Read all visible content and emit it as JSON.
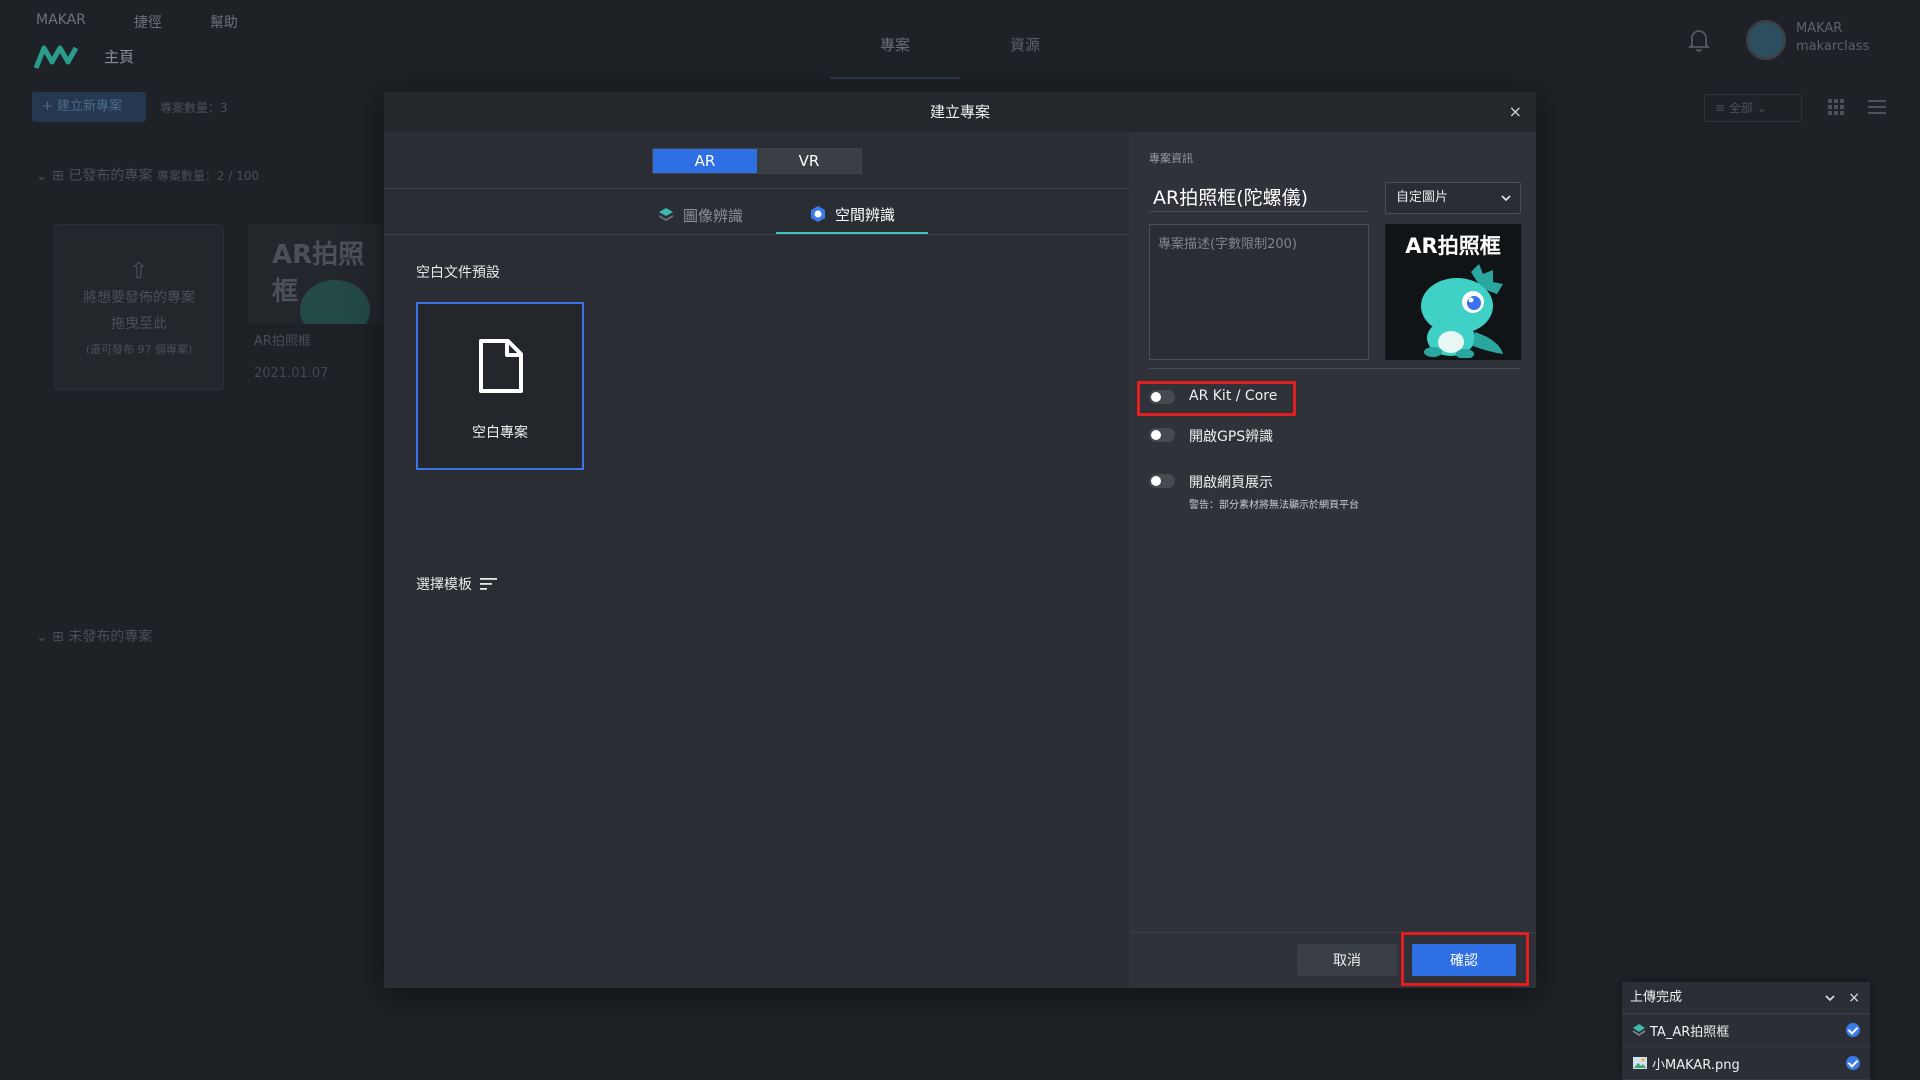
{
  "app": {
    "menu": [
      "MAKAR",
      "捷徑",
      "幫助"
    ],
    "home_label": "主頁",
    "top_tabs": [
      "專案",
      "資源"
    ],
    "user": {
      "name": "MAKAR",
      "handle": "makarclass"
    },
    "new_project_label": "+ 建立新專案",
    "project_count_label": "專案數量：3",
    "view_filter_label": "全部",
    "published_section": "已發布的專案",
    "published_count": "專案數量：2 / 100",
    "unpublished_section": "未發布的專案",
    "drop_card": {
      "line1": "將想要發佈的專案",
      "line2": "拖曳至此",
      "line3": "(還可發布 97 個專案)"
    },
    "project_card": {
      "thumb_title": "AR拍照框",
      "name": "AR拍照框",
      "date": "2021.01.07"
    }
  },
  "modal": {
    "title": "建立專案",
    "close_label": "×",
    "mode_tabs": [
      {
        "label": "AR",
        "active": true
      },
      {
        "label": "VR",
        "active": false
      }
    ],
    "recognition_tabs": [
      {
        "label": "圖像辨識",
        "active": false
      },
      {
        "label": "空間辨識",
        "active": true
      }
    ],
    "blank_preset_label": "空白文件預設",
    "blank_project_label": "空白專案",
    "template_label": "選擇模板",
    "info": {
      "section_label": "專案資訊",
      "project_name": "AR拍照框(陀螺儀)",
      "image_select": "自定圖片",
      "description_placeholder": "專案描述(字數限制200)",
      "thumbnail_title": "AR拍照框"
    },
    "toggles": [
      {
        "label": "AR Kit / Core",
        "on": false
      },
      {
        "label": "開啟GPS辨識",
        "on": false
      },
      {
        "label": "開啟網頁展示",
        "on": false,
        "warning": "警告：部分素材將無法顯示於網頁平台"
      }
    ],
    "cancel_label": "取消",
    "confirm_label": "確認"
  },
  "upload": {
    "title": "上傳完成",
    "close_label": "×",
    "items": [
      {
        "name": "TA_AR拍照框",
        "status": "done"
      },
      {
        "name": "小MAKAR.png",
        "status": "done"
      }
    ]
  },
  "colors": {
    "accent": "#2f6fe4",
    "tab_underline": "#3fc4c8",
    "highlight": "#e41e1e"
  }
}
